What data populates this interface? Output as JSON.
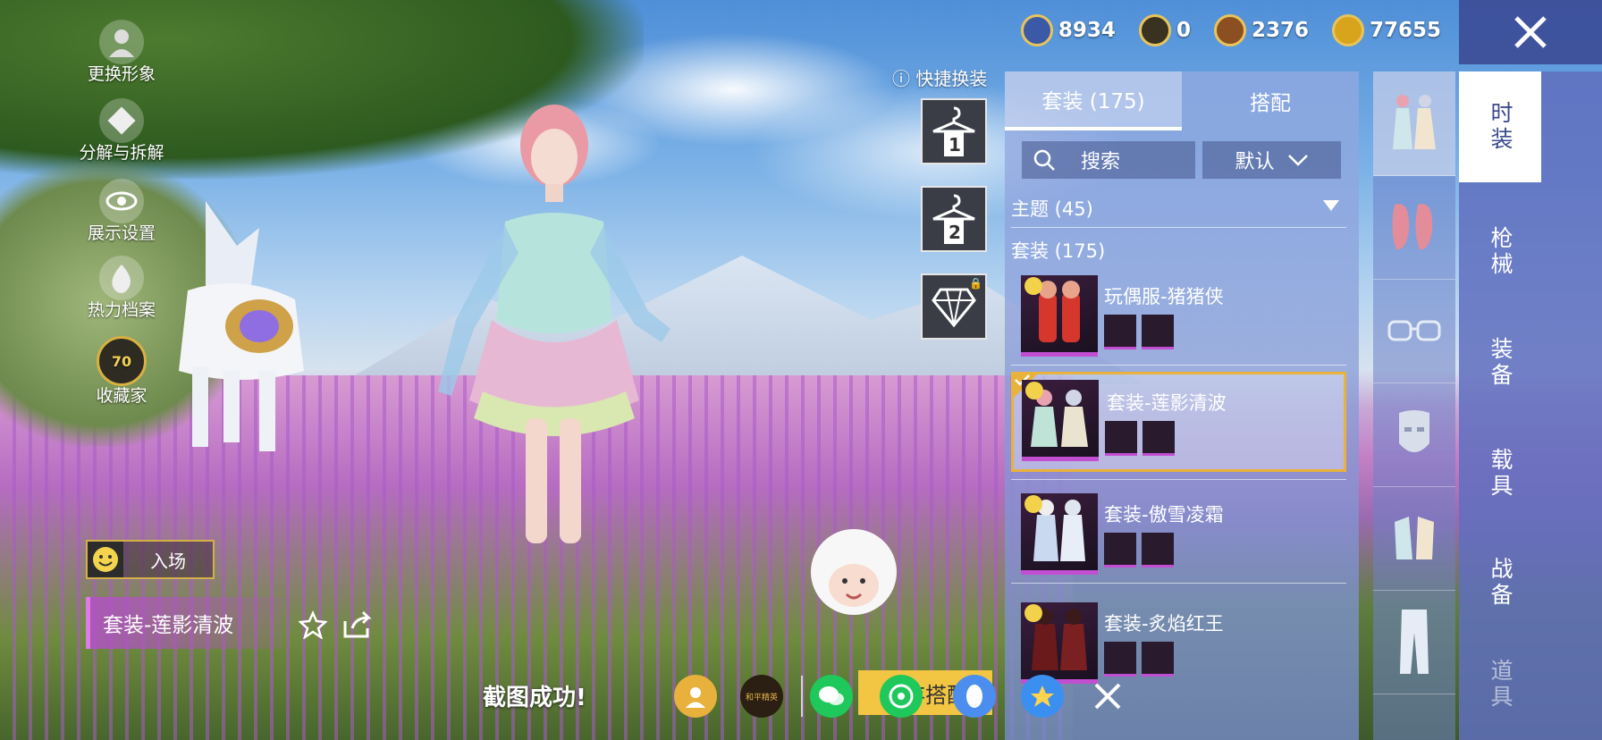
{
  "currencies": [
    {
      "icon": "globe-coin-icon",
      "value": "8934",
      "color": "#6a8ed8"
    },
    {
      "icon": "triangle-coin-icon",
      "value": "0",
      "color": "#e7b53a"
    },
    {
      "icon": "bp-coin-icon",
      "value": "2376",
      "color": "#a0602c"
    },
    {
      "icon": "lightning-coin-icon",
      "value": "77655",
      "color": "#f0c030"
    }
  ],
  "left_menu": [
    {
      "label": "更换形象",
      "icon": "avatar-icon"
    },
    {
      "label": "分解与拆解",
      "icon": "puzzle-icon"
    },
    {
      "label": "展示设置",
      "icon": "eye-icon"
    },
    {
      "label": "热力档案",
      "icon": "flame-icon"
    },
    {
      "label": "收藏家",
      "icon": "collector-badge-icon",
      "badge": "70"
    }
  ],
  "entrance": {
    "label": "入场"
  },
  "current_outfit": {
    "name": "套装-莲影清波"
  },
  "quick_change": {
    "title": "快捷换装",
    "slots": [
      "1",
      "2"
    ]
  },
  "panel": {
    "tabs": [
      {
        "label": "套装 (175)",
        "active": true
      },
      {
        "label": "搭配",
        "active": false
      }
    ],
    "search_label": "搜索",
    "sort_label": "默认",
    "theme_header": "主题 (45)",
    "suits_header": "套装 (175)",
    "items": [
      {
        "title": "玩偶服-猪猪侠",
        "selected": false
      },
      {
        "title": "套装-莲影清波",
        "selected": true
      },
      {
        "title": "套装-傲雪凌霜",
        "selected": false
      },
      {
        "title": "套装-炙焰红王",
        "selected": false
      }
    ]
  },
  "category_nav": [
    {
      "label": "时装",
      "active": true
    },
    {
      "label": "枪械",
      "active": false
    },
    {
      "label": "装备",
      "active": false
    },
    {
      "label": "载具",
      "active": false
    },
    {
      "label": "战备",
      "active": false
    },
    {
      "label": "道具",
      "active": false
    }
  ],
  "share_bar": {
    "message": "截图成功!",
    "save_label": "保存搭配",
    "close_icon": "close-icon",
    "brand_badge": "和平精英"
  }
}
